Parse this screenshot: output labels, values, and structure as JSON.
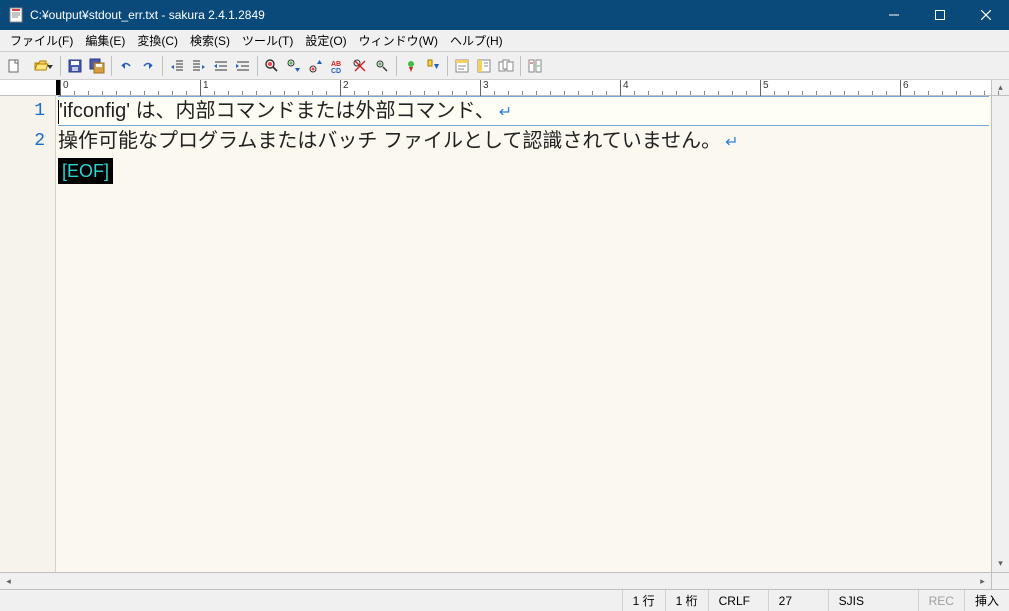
{
  "title": "C:¥output¥stdout_err.txt - sakura 2.4.1.2849",
  "menus": [
    "ファイル(F)",
    "編集(E)",
    "変換(C)",
    "検索(S)",
    "ツール(T)",
    "設定(O)",
    "ウィンドウ(W)",
    "ヘルプ(H)"
  ],
  "ruler_majors": [
    0,
    1,
    2,
    3,
    4,
    5,
    6
  ],
  "lines": [
    {
      "num": "1",
      "text": "'ifconfig' は、内部コマンドまたは外部コマンド、",
      "caret": true
    },
    {
      "num": "2",
      "text": "操作可能なプログラムまたはバッチ ファイルとして認識されていません。",
      "caret": false
    }
  ],
  "eof": "[EOF]",
  "status": {
    "line": "1 行",
    "col": "1 桁",
    "newline": "CRLF",
    "code": "27",
    "encoding": "SJIS",
    "rec": "REC",
    "insert": "挿入"
  },
  "toolbar_icons": [
    "new-file-icon",
    "open-file-icon",
    "sep",
    "save-icon",
    "save-all-icon",
    "sep",
    "undo-icon",
    "redo-icon",
    "sep",
    "indent-left-icon",
    "indent-right-icon",
    "outdent-icon",
    "indent-icon",
    "sep",
    "find-icon",
    "find-next-icon",
    "find-prev-icon",
    "replace-icon",
    "find-mark-icon",
    "clear-mark-icon",
    "sep",
    "bookmark-toggle-icon",
    "bookmark-next-icon",
    "sep",
    "outline-icon",
    "type-list-icon",
    "tab-list-icon",
    "sep",
    "compare-icon"
  ]
}
